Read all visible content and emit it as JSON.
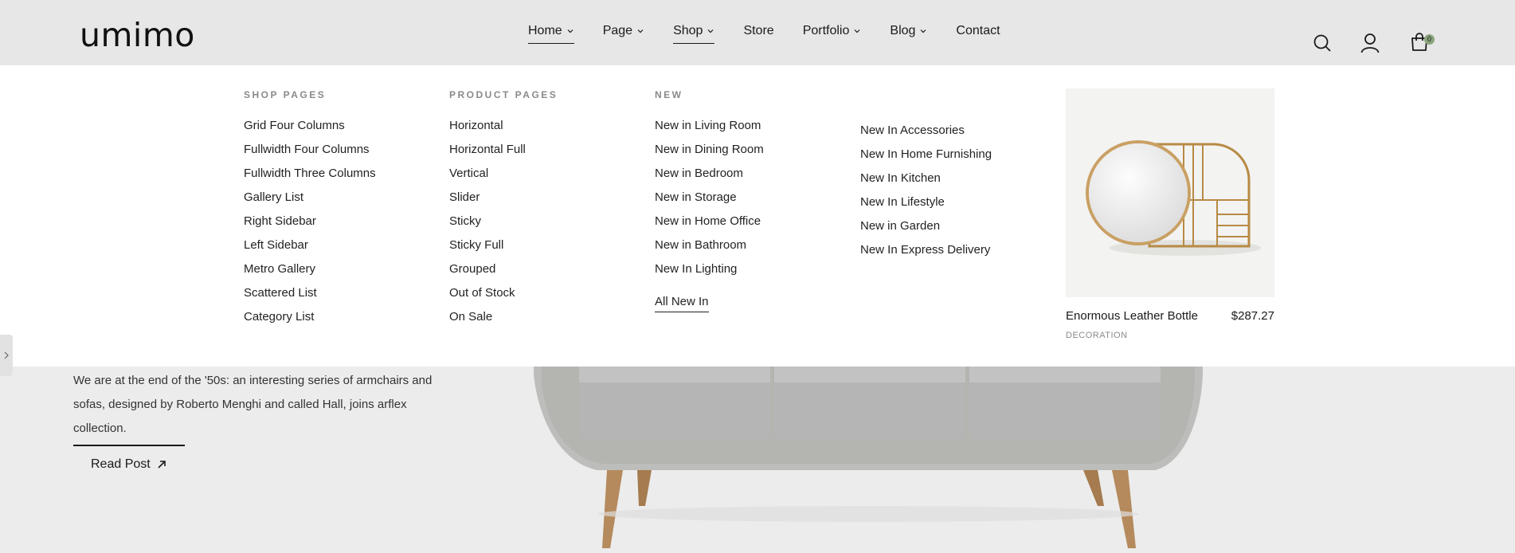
{
  "brand": {
    "logo_text": "umimo"
  },
  "nav": {
    "items": [
      {
        "label": "Home",
        "has_dropdown": true,
        "active": true
      },
      {
        "label": "Page",
        "has_dropdown": true,
        "active": false
      },
      {
        "label": "Shop",
        "has_dropdown": true,
        "active": true
      },
      {
        "label": "Store",
        "has_dropdown": false,
        "active": false
      },
      {
        "label": "Portfolio",
        "has_dropdown": true,
        "active": false
      },
      {
        "label": "Blog",
        "has_dropdown": true,
        "active": false
      },
      {
        "label": "Contact",
        "has_dropdown": false,
        "active": false
      }
    ]
  },
  "header_icons": [
    "search-icon",
    "user-icon",
    "cart-icon"
  ],
  "cart": {
    "count": "0"
  },
  "mega_menu": {
    "shop_pages": {
      "title": "SHOP PAGES",
      "items": [
        "Grid Four Columns",
        "Fullwidth Four Columns",
        "Fullwidth Three Columns",
        "Gallery List",
        "Right Sidebar",
        "Left Sidebar",
        "Metro Gallery",
        "Scattered List",
        "Category List"
      ]
    },
    "product_pages": {
      "title": "PRODUCT PAGES",
      "items": [
        "Horizontal",
        "Horizontal Full",
        "Vertical",
        "Slider",
        "Sticky",
        "Sticky Full",
        "Grouped",
        "Out of Stock",
        "On Sale"
      ]
    },
    "new": {
      "title": "NEW",
      "items": [
        "New in Living Room",
        "New in Dining Room",
        "New in Bedroom",
        "New in Storage",
        "New in Home Office",
        "New in Bathroom",
        "New In Lighting"
      ],
      "all_link": "All New In"
    },
    "new_more": {
      "items": [
        "New In Accessories",
        "New In Home Furnishing",
        "New In Kitchen",
        "New In Lifestyle",
        "New in Garden",
        "New In Express Delivery"
      ]
    },
    "featured_product": {
      "name": "Enormous Leather Bottle",
      "price": "$287.27",
      "category": "DECORATION"
    }
  },
  "hero": {
    "text": "We are at the end of the '50s: an interesting series of armchairs and sofas, designed by Roberto Menghi and called Hall, joins arflex collection.",
    "cta": "Read Post"
  },
  "colors": {
    "badge": "#8aa37b",
    "header_bg": "#e7e7e7",
    "menu_bg": "#ffffff",
    "page_bg": "#ececec"
  }
}
